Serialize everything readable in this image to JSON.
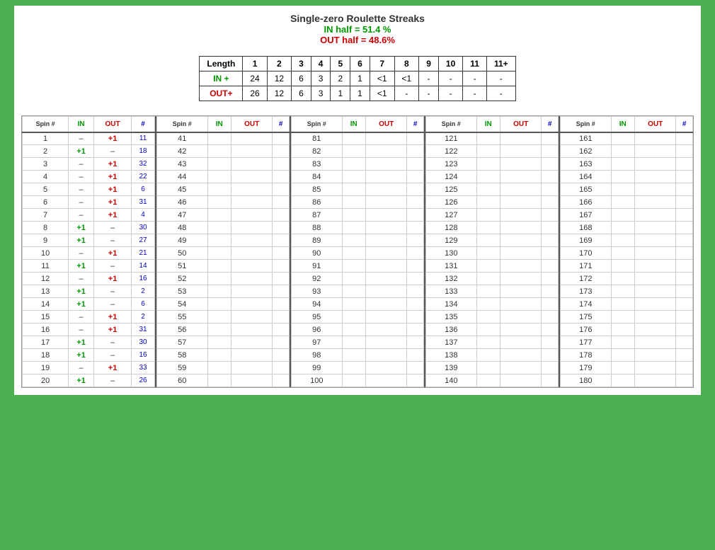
{
  "title": {
    "main": "Single-zero Roulette Streaks",
    "in_half": "IN half = 51.4 %",
    "out_half": "OUT half = 48.6%"
  },
  "summary": {
    "headers": [
      "Length",
      "1",
      "2",
      "3",
      "4",
      "5",
      "6",
      "7",
      "8",
      "9",
      "10",
      "11",
      "11+"
    ],
    "in_row": {
      "label": "IN +",
      "values": [
        "24",
        "12",
        "6",
        "3",
        "2",
        "1",
        "<1",
        "<1",
        "-",
        "-",
        "-",
        "-"
      ]
    },
    "out_row": {
      "label": "OUT+",
      "values": [
        "26",
        "12",
        "6",
        "3",
        "1",
        "1",
        "<1",
        "-",
        "-",
        "-",
        "-",
        "-"
      ]
    }
  },
  "spin_headers": [
    "Spin #",
    "IN",
    "OUT",
    "#"
  ],
  "spin_columns": [
    {
      "rows": [
        {
          "spin": "1",
          "in": "–",
          "out": "+1",
          "num": "11"
        },
        {
          "spin": "2",
          "in": "+1",
          "out": "–",
          "num": "18"
        },
        {
          "spin": "3",
          "in": "–",
          "out": "+1",
          "num": "32"
        },
        {
          "spin": "4",
          "in": "–",
          "out": "+1",
          "num": "22"
        },
        {
          "spin": "5",
          "in": "–",
          "out": "+1",
          "num": "6"
        },
        {
          "spin": "6",
          "in": "–",
          "out": "+1",
          "num": "31"
        },
        {
          "spin": "7",
          "in": "–",
          "out": "+1",
          "num": "4"
        },
        {
          "spin": "8",
          "in": "+1",
          "out": "–",
          "num": "30"
        },
        {
          "spin": "9",
          "in": "+1",
          "out": "–",
          "num": "27"
        },
        {
          "spin": "10",
          "in": "–",
          "out": "+1",
          "num": "21"
        },
        {
          "spin": "11",
          "in": "+1",
          "out": "–",
          "num": "14"
        },
        {
          "spin": "12",
          "in": "–",
          "out": "+1",
          "num": "16"
        },
        {
          "spin": "13",
          "in": "+1",
          "out": "–",
          "num": "2"
        },
        {
          "spin": "14",
          "in": "+1",
          "out": "–",
          "num": "6"
        },
        {
          "spin": "15",
          "in": "–",
          "out": "+1",
          "num": "2"
        },
        {
          "spin": "16",
          "in": "–",
          "out": "+1",
          "num": "31"
        },
        {
          "spin": "17",
          "in": "+1",
          "out": "–",
          "num": "30"
        },
        {
          "spin": "18",
          "in": "+1",
          "out": "–",
          "num": "16"
        },
        {
          "spin": "19",
          "in": "–",
          "out": "+1",
          "num": "33"
        },
        {
          "spin": "20",
          "in": "+1",
          "out": "–",
          "num": "26"
        }
      ]
    },
    {
      "rows": [
        {
          "spin": "41",
          "in": "",
          "out": "",
          "num": ""
        },
        {
          "spin": "42",
          "in": "",
          "out": "",
          "num": ""
        },
        {
          "spin": "43",
          "in": "",
          "out": "",
          "num": ""
        },
        {
          "spin": "44",
          "in": "",
          "out": "",
          "num": ""
        },
        {
          "spin": "45",
          "in": "",
          "out": "",
          "num": ""
        },
        {
          "spin": "46",
          "in": "",
          "out": "",
          "num": ""
        },
        {
          "spin": "47",
          "in": "",
          "out": "",
          "num": ""
        },
        {
          "spin": "48",
          "in": "",
          "out": "",
          "num": ""
        },
        {
          "spin": "49",
          "in": "",
          "out": "",
          "num": ""
        },
        {
          "spin": "50",
          "in": "",
          "out": "",
          "num": ""
        },
        {
          "spin": "51",
          "in": "",
          "out": "",
          "num": ""
        },
        {
          "spin": "52",
          "in": "",
          "out": "",
          "num": ""
        },
        {
          "spin": "53",
          "in": "",
          "out": "",
          "num": ""
        },
        {
          "spin": "54",
          "in": "",
          "out": "",
          "num": ""
        },
        {
          "spin": "55",
          "in": "",
          "out": "",
          "num": ""
        },
        {
          "spin": "56",
          "in": "",
          "out": "",
          "num": ""
        },
        {
          "spin": "57",
          "in": "",
          "out": "",
          "num": ""
        },
        {
          "spin": "58",
          "in": "",
          "out": "",
          "num": ""
        },
        {
          "spin": "59",
          "in": "",
          "out": "",
          "num": ""
        },
        {
          "spin": "60",
          "in": "",
          "out": "",
          "num": ""
        }
      ]
    },
    {
      "rows": [
        {
          "spin": "81",
          "in": "",
          "out": "",
          "num": ""
        },
        {
          "spin": "82",
          "in": "",
          "out": "",
          "num": ""
        },
        {
          "spin": "83",
          "in": "",
          "out": "",
          "num": ""
        },
        {
          "spin": "84",
          "in": "",
          "out": "",
          "num": ""
        },
        {
          "spin": "85",
          "in": "",
          "out": "",
          "num": ""
        },
        {
          "spin": "86",
          "in": "",
          "out": "",
          "num": ""
        },
        {
          "spin": "87",
          "in": "",
          "out": "",
          "num": ""
        },
        {
          "spin": "88",
          "in": "",
          "out": "",
          "num": ""
        },
        {
          "spin": "89",
          "in": "",
          "out": "",
          "num": ""
        },
        {
          "spin": "90",
          "in": "",
          "out": "",
          "num": ""
        },
        {
          "spin": "91",
          "in": "",
          "out": "",
          "num": ""
        },
        {
          "spin": "92",
          "in": "",
          "out": "",
          "num": ""
        },
        {
          "spin": "93",
          "in": "",
          "out": "",
          "num": ""
        },
        {
          "spin": "94",
          "in": "",
          "out": "",
          "num": ""
        },
        {
          "spin": "95",
          "in": "",
          "out": "",
          "num": ""
        },
        {
          "spin": "96",
          "in": "",
          "out": "",
          "num": ""
        },
        {
          "spin": "97",
          "in": "",
          "out": "",
          "num": ""
        },
        {
          "spin": "98",
          "in": "",
          "out": "",
          "num": ""
        },
        {
          "spin": "99",
          "in": "",
          "out": "",
          "num": ""
        },
        {
          "spin": "100",
          "in": "",
          "out": "",
          "num": ""
        }
      ]
    },
    {
      "rows": [
        {
          "spin": "121",
          "in": "",
          "out": "",
          "num": ""
        },
        {
          "spin": "122",
          "in": "",
          "out": "",
          "num": ""
        },
        {
          "spin": "123",
          "in": "",
          "out": "",
          "num": ""
        },
        {
          "spin": "124",
          "in": "",
          "out": "",
          "num": ""
        },
        {
          "spin": "125",
          "in": "",
          "out": "",
          "num": ""
        },
        {
          "spin": "126",
          "in": "",
          "out": "",
          "num": ""
        },
        {
          "spin": "127",
          "in": "",
          "out": "",
          "num": ""
        },
        {
          "spin": "128",
          "in": "",
          "out": "",
          "num": ""
        },
        {
          "spin": "129",
          "in": "",
          "out": "",
          "num": ""
        },
        {
          "spin": "130",
          "in": "",
          "out": "",
          "num": ""
        },
        {
          "spin": "131",
          "in": "",
          "out": "",
          "num": ""
        },
        {
          "spin": "132",
          "in": "",
          "out": "",
          "num": ""
        },
        {
          "spin": "133",
          "in": "",
          "out": "",
          "num": ""
        },
        {
          "spin": "134",
          "in": "",
          "out": "",
          "num": ""
        },
        {
          "spin": "135",
          "in": "",
          "out": "",
          "num": ""
        },
        {
          "spin": "136",
          "in": "",
          "out": "",
          "num": ""
        },
        {
          "spin": "137",
          "in": "",
          "out": "",
          "num": ""
        },
        {
          "spin": "138",
          "in": "",
          "out": "",
          "num": ""
        },
        {
          "spin": "139",
          "in": "",
          "out": "",
          "num": ""
        },
        {
          "spin": "140",
          "in": "",
          "out": "",
          "num": ""
        }
      ]
    },
    {
      "rows": [
        {
          "spin": "161",
          "in": "",
          "out": "",
          "num": ""
        },
        {
          "spin": "162",
          "in": "",
          "out": "",
          "num": ""
        },
        {
          "spin": "163",
          "in": "",
          "out": "",
          "num": ""
        },
        {
          "spin": "164",
          "in": "",
          "out": "",
          "num": ""
        },
        {
          "spin": "165",
          "in": "",
          "out": "",
          "num": ""
        },
        {
          "spin": "166",
          "in": "",
          "out": "",
          "num": ""
        },
        {
          "spin": "167",
          "in": "",
          "out": "",
          "num": ""
        },
        {
          "spin": "168",
          "in": "",
          "out": "",
          "num": ""
        },
        {
          "spin": "169",
          "in": "",
          "out": "",
          "num": ""
        },
        {
          "spin": "170",
          "in": "",
          "out": "",
          "num": ""
        },
        {
          "spin": "171",
          "in": "",
          "out": "",
          "num": ""
        },
        {
          "spin": "172",
          "in": "",
          "out": "",
          "num": ""
        },
        {
          "spin": "173",
          "in": "",
          "out": "",
          "num": ""
        },
        {
          "spin": "174",
          "in": "",
          "out": "",
          "num": ""
        },
        {
          "spin": "175",
          "in": "",
          "out": "",
          "num": ""
        },
        {
          "spin": "176",
          "in": "",
          "out": "",
          "num": ""
        },
        {
          "spin": "177",
          "in": "",
          "out": "",
          "num": ""
        },
        {
          "spin": "178",
          "in": "",
          "out": "",
          "num": ""
        },
        {
          "spin": "179",
          "in": "",
          "out": "",
          "num": ""
        },
        {
          "spin": "180",
          "in": "",
          "out": "",
          "num": ""
        }
      ]
    }
  ]
}
